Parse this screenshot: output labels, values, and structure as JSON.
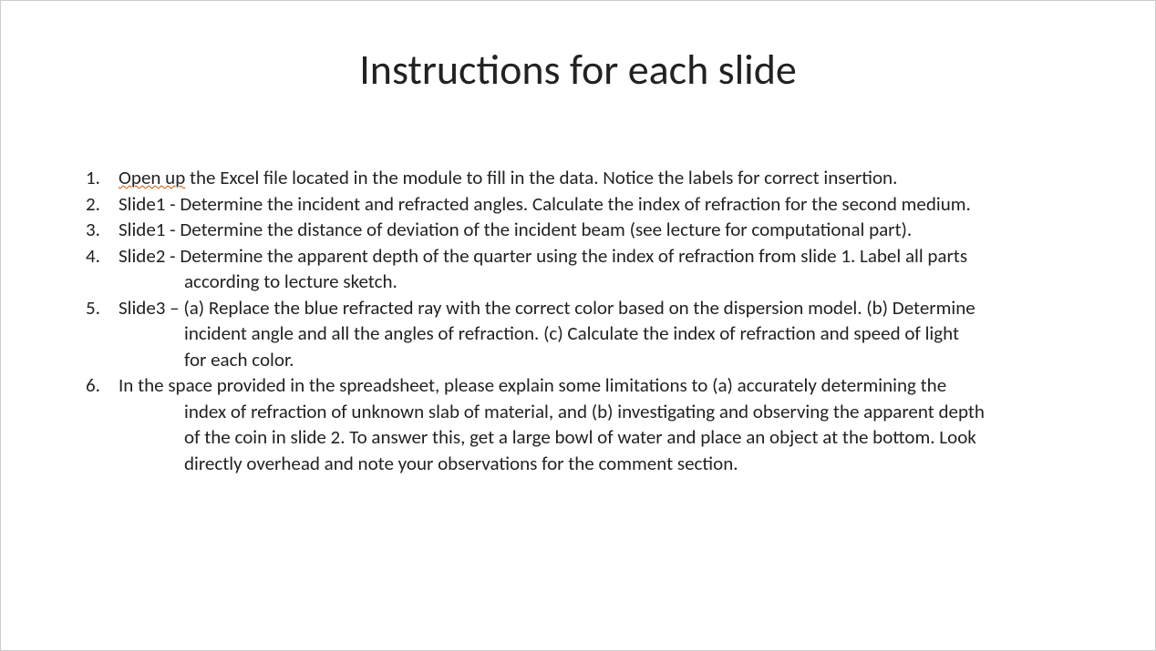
{
  "title": "Instructions for each slide",
  "items": [
    {
      "num": "1.",
      "lines": [
        {
          "type": "first",
          "squig": "Open up",
          "rest": " the Excel file located in the module to fill in the data. Notice the labels for correct insertion."
        }
      ]
    },
    {
      "num": "2.",
      "lines": [
        {
          "type": "plain",
          "text": "Slide1 -  Determine the incident and refracted angles. Calculate the index of refraction for the second medium."
        }
      ]
    },
    {
      "num": "3.",
      "lines": [
        {
          "type": "plain",
          "text": "Slide1 - Determine the distance of deviation of the incident beam (see lecture for computational part)."
        }
      ]
    },
    {
      "num": "4.",
      "lines": [
        {
          "type": "plain",
          "text": "Slide2 - Determine the apparent depth of the quarter using the index of refraction from slide 1. Label all parts"
        },
        {
          "type": "cont",
          "text": "according to lecture sketch."
        }
      ]
    },
    {
      "num": "5.",
      "lines": [
        {
          "type": "plain",
          "text": "Slide3 – (a) Replace the blue refracted ray with the correct color based on the dispersion model. (b) Determine"
        },
        {
          "type": "cont",
          "text": "incident angle and all the angles of refraction. (c) Calculate the index of refraction and speed of light"
        },
        {
          "type": "cont",
          "text": "for each color."
        }
      ]
    },
    {
      "num": "6.",
      "lines": [
        {
          "type": "plain",
          "text": "In the space provided in the spreadsheet, please explain some limitations to (a) accurately determining the"
        },
        {
          "type": "cont",
          "text": " index of refraction of unknown slab of material, and (b) investigating and observing the apparent depth"
        },
        {
          "type": "cont",
          "text": "of the coin in slide 2. To answer this, get a large bowl of water and place an object at the bottom. Look"
        },
        {
          "type": "cont",
          "text": "directly overhead and note your observations for the comment section."
        }
      ]
    }
  ]
}
